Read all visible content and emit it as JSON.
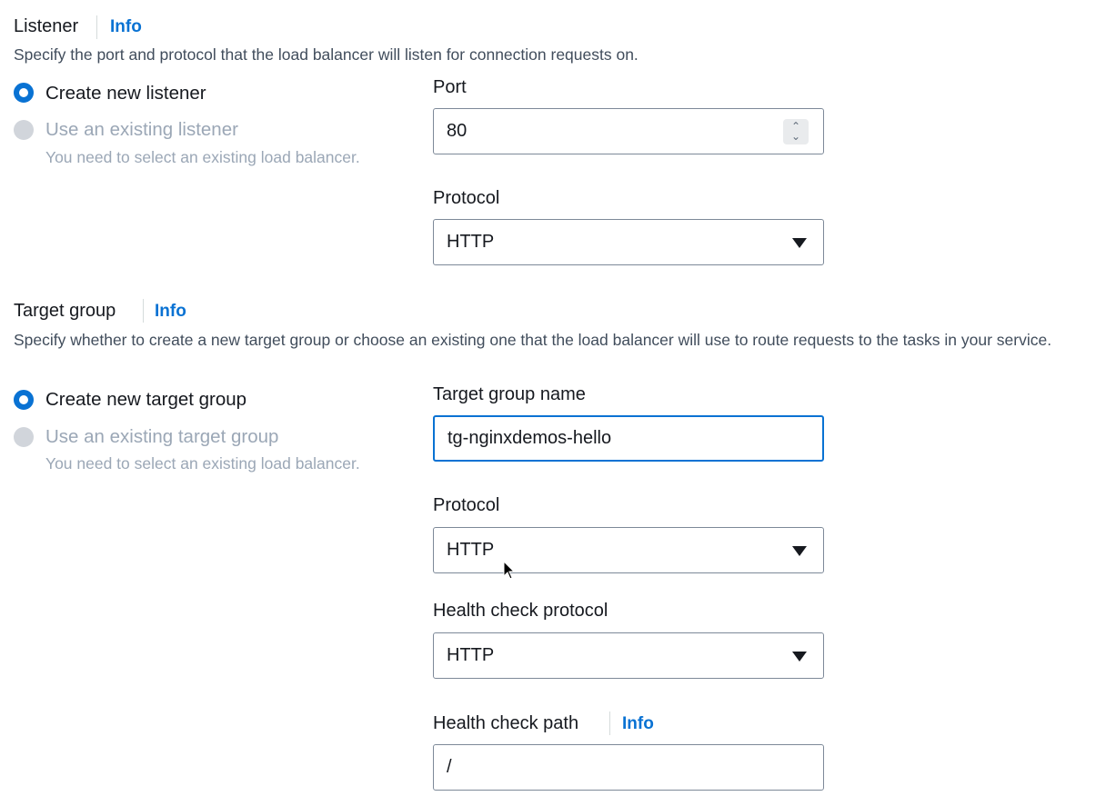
{
  "listener": {
    "title": "Listener",
    "info_label": "Info",
    "description": "Specify the port and protocol that the load balancer will listen for connection requests on.",
    "options": [
      {
        "label": "Create new listener",
        "checked": true,
        "disabled": false
      },
      {
        "label": "Use an existing listener",
        "checked": false,
        "disabled": true,
        "hint": "You need to select an existing load balancer."
      }
    ],
    "port": {
      "label": "Port",
      "value": "80"
    },
    "protocol": {
      "label": "Protocol",
      "value": "HTTP"
    }
  },
  "target_group": {
    "title": "Target group",
    "info_label": "Info",
    "description": "Specify whether to create a new target group or choose an existing one that the load balancer will use to route requests to the tasks in your service.",
    "options": [
      {
        "label": "Create new target group",
        "checked": true,
        "disabled": false
      },
      {
        "label": "Use an existing target group",
        "checked": false,
        "disabled": true,
        "hint": "You need to select an existing load balancer."
      }
    ],
    "name": {
      "label": "Target group name",
      "value": "tg-nginxdemos-hello"
    },
    "protocol": {
      "label": "Protocol",
      "value": "HTTP"
    },
    "health_check_protocol": {
      "label": "Health check protocol",
      "value": "HTTP"
    },
    "health_check_path": {
      "label": "Health check path",
      "info_label": "Info",
      "value": "/"
    }
  },
  "colors": {
    "link": "#0972d3",
    "radio_checked": "#0972d3",
    "disabled_text": "#9ba7b6",
    "border": "#7d8998"
  }
}
